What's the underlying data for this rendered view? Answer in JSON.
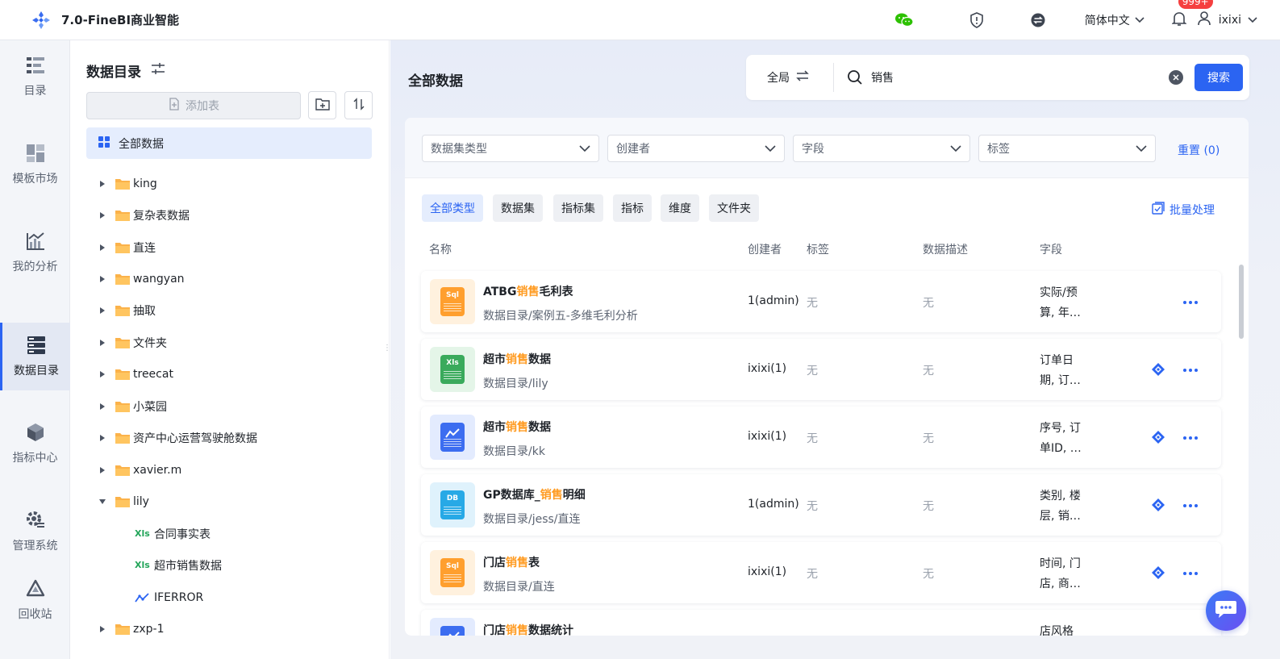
{
  "topbar": {
    "title": "7.0-FineBI商业智能",
    "language": "简体中文",
    "notification_count": "999+",
    "username": "ixixi"
  },
  "leftnav": {
    "items": [
      {
        "label": "目录",
        "icon": "catalog-icon"
      },
      {
        "label": "模板市场",
        "icon": "template-market-icon"
      },
      {
        "label": "我的分析",
        "icon": "analysis-chart-icon"
      },
      {
        "label": "数据目录",
        "icon": "data-catalog-icon",
        "active": true
      },
      {
        "label": "指标中心",
        "icon": "metrics-center-icon"
      },
      {
        "label": "管理系统",
        "icon": "admin-gear-icon"
      },
      {
        "label": "回收站",
        "icon": "recycle-bin-icon"
      }
    ]
  },
  "catalog": {
    "title": "数据目录",
    "add_table_label": "添加表",
    "all_data_label": "全部数据",
    "tree": [
      {
        "name": "king",
        "expanded": false
      },
      {
        "name": "复杂表数据",
        "expanded": false
      },
      {
        "name": "直连",
        "expanded": false
      },
      {
        "name": "wangyan",
        "expanded": false
      },
      {
        "name": "抽取",
        "expanded": false
      },
      {
        "name": "文件夹",
        "expanded": false
      },
      {
        "name": "treecat",
        "expanded": false
      },
      {
        "name": "小菜园",
        "expanded": false
      },
      {
        "name": "资产中心运营驾驶舱数据",
        "expanded": false
      },
      {
        "name": "xavier.m",
        "expanded": false
      },
      {
        "name": "lily",
        "expanded": true
      },
      {
        "name": "zxp-1",
        "expanded": false
      }
    ],
    "lily_children": [
      {
        "name": "合同事实表",
        "type": "xls",
        "badge": "Xls"
      },
      {
        "name": "超市销售数据",
        "type": "xls",
        "badge": "Xls"
      },
      {
        "name": "IFERROR",
        "type": "metric"
      }
    ]
  },
  "main": {
    "title": "全部数据",
    "search": {
      "scope_label": "全局",
      "query": "销售",
      "button_label": "搜索"
    },
    "filters": [
      {
        "placeholder": "数据集类型"
      },
      {
        "placeholder": "创建者"
      },
      {
        "placeholder": "字段"
      },
      {
        "placeholder": "标签"
      }
    ],
    "reset_label": "重置 (0)",
    "type_tabs": [
      {
        "label": "全部类型",
        "active": true
      },
      {
        "label": "数据集"
      },
      {
        "label": "指标集"
      },
      {
        "label": "指标"
      },
      {
        "label": "维度"
      },
      {
        "label": "文件夹"
      }
    ],
    "batch_label": "批量处理",
    "columns": {
      "name": "名称",
      "creator": "创建者",
      "tags": "标签",
      "description": "数据描述",
      "fields": "字段"
    },
    "rows": [
      {
        "icon_type": "sql",
        "icon_text": "Sql",
        "name_pre": "ATBG",
        "name_hl": "销售",
        "name_post": "毛利表",
        "path": "数据目录/案例五-多维毛利分析",
        "creator": "1(admin)",
        "tags": "无",
        "desc": "无",
        "fields_l1": "实际/预",
        "fields_l2": "算, 年…",
        "has_link": false
      },
      {
        "icon_type": "xls",
        "icon_text": "Xls",
        "name_pre": "超市",
        "name_hl": "销售",
        "name_post": "数据",
        "path": "数据目录/lily",
        "creator": "ixixi(1)",
        "tags": "无",
        "desc": "无",
        "fields_l1": "订单日",
        "fields_l2": "期, 订…",
        "has_link": true
      },
      {
        "icon_type": "chart",
        "icon_text": "",
        "name_pre": "超市",
        "name_hl": "销售",
        "name_post": "数据",
        "path": "数据目录/kk",
        "creator": "ixixi(1)",
        "tags": "无",
        "desc": "无",
        "fields_l1": "序号, 订",
        "fields_l2": "单ID, …",
        "has_link": true
      },
      {
        "icon_type": "db",
        "icon_text": "DB",
        "name_pre": "GP数据库_",
        "name_hl": "销售",
        "name_post": "明细",
        "path": "数据目录/jess/直连",
        "creator": "1(admin)",
        "tags": "无",
        "desc": "无",
        "fields_l1": "类别, 楼",
        "fields_l2": "层, 销…",
        "has_link": true
      },
      {
        "icon_type": "sql",
        "icon_text": "Sql",
        "name_pre": "门店",
        "name_hl": "销售",
        "name_post": "表",
        "path": "数据目录/直连",
        "creator": "ixixi(1)",
        "tags": "无",
        "desc": "无",
        "fields_l1": "时间, 门",
        "fields_l2": "店, 商…",
        "has_link": true
      },
      {
        "icon_type": "chart",
        "icon_text": "",
        "name_pre": "门店",
        "name_hl": "销售",
        "name_post": "数据统计",
        "path": "",
        "creator": "",
        "tags": "",
        "desc": "",
        "fields_l1": "店风格",
        "fields_l2": "",
        "has_link": false
      }
    ]
  },
  "colors": {
    "primary": "#2b64f2",
    "highlight": "#ff9a1f",
    "sql_icon": "#ff9f2e",
    "xls_icon": "#3aaa5c",
    "chart_icon": "#3c6df0",
    "db_icon": "#27a9e6"
  }
}
